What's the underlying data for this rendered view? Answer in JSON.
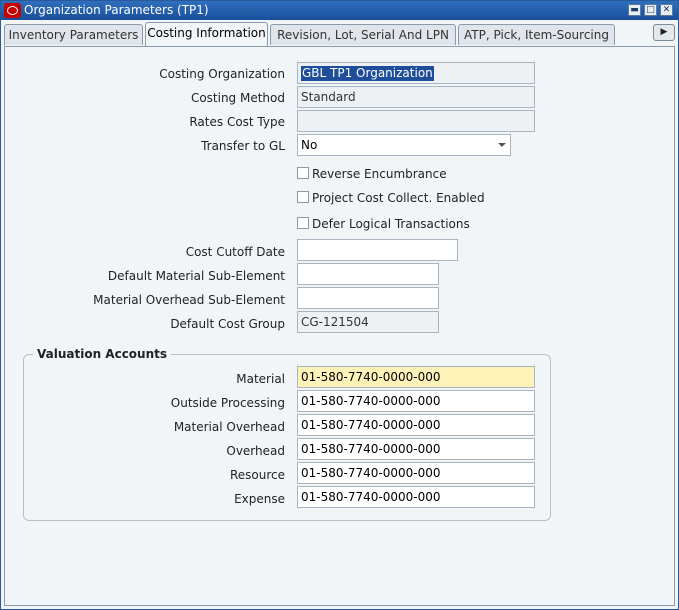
{
  "window": {
    "title": "Organization Parameters (TP1)",
    "controls": {
      "minimize": "▬",
      "maximize": "□",
      "close": "✕"
    }
  },
  "tabs": [
    {
      "label": "Inventory Parameters",
      "active": false
    },
    {
      "label": "Costing Information",
      "active": true
    },
    {
      "label": "Revision, Lot, Serial And LPN",
      "active": false
    },
    {
      "label": "ATP, Pick, Item-Sourcing",
      "active": false
    }
  ],
  "tab_scroll_glyph": "▶",
  "costing": {
    "costing_org_label": "Costing Organization",
    "costing_org_value": "GBL TP1 Organization",
    "costing_method_label": "Costing Method",
    "costing_method_value": "Standard",
    "rates_cost_type_label": "Rates Cost Type",
    "rates_cost_type_value": "",
    "transfer_gl_label": "Transfer to GL",
    "transfer_gl_value": "No",
    "reverse_encumbrance_label": "Reverse Encumbrance",
    "reverse_encumbrance_checked": false,
    "project_cost_label": "Project Cost Collect. Enabled",
    "project_cost_checked": false,
    "defer_logical_label": "Defer Logical Transactions",
    "defer_logical_checked": false,
    "cost_cutoff_label": "Cost Cutoff Date",
    "cost_cutoff_value": "",
    "default_material_sub_label": "Default Material Sub-Element",
    "default_material_sub_value": "",
    "material_overhead_sub_label": "Material Overhead Sub-Element",
    "material_overhead_sub_value": "",
    "default_cost_group_label": "Default Cost Group",
    "default_cost_group_value": "CG-121504"
  },
  "valuation": {
    "title": "Valuation Accounts",
    "material_label": "Material",
    "material_value": "01-580-7740-0000-000",
    "outside_processing_label": "Outside Processing",
    "outside_processing_value": "01-580-7740-0000-000",
    "material_overhead_label": "Material Overhead",
    "material_overhead_value": "01-580-7740-0000-000",
    "overhead_label": "Overhead",
    "overhead_value": "01-580-7740-0000-000",
    "resource_label": "Resource",
    "resource_value": "01-580-7740-0000-000",
    "expense_label": "Expense",
    "expense_value": "01-580-7740-0000-000"
  },
  "colors": {
    "titlebar": "#1a4f9a",
    "required_field": "#fff2b8",
    "selection": "#1e4e9a"
  }
}
